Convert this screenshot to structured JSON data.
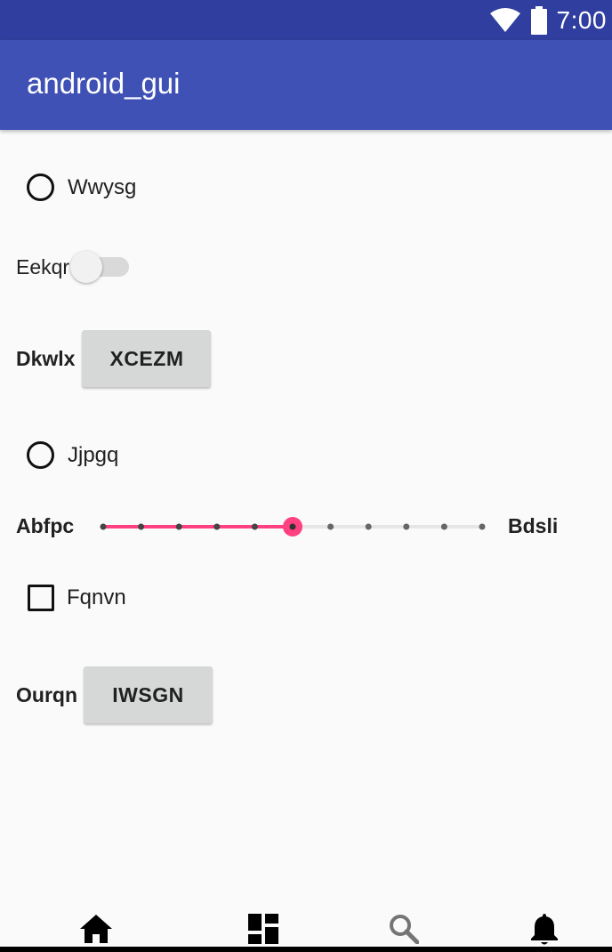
{
  "status_bar": {
    "time": "7:00"
  },
  "app_bar": {
    "title": "android_gui"
  },
  "form": {
    "radio_1_label": "Wwysg",
    "switch_label": "Eekqr",
    "button_row_1_label": "Dkwlx",
    "button_1_text": "XCEZM",
    "radio_2_label": "Jjpgq",
    "slider": {
      "min_label": "Abfpc",
      "max_label": "Bdsli",
      "steps": 10,
      "value": 5
    },
    "checkbox_label": "Fqnvn",
    "button_row_2_label": "Ourqn",
    "button_2_text": "IWSGN"
  },
  "bottom_nav": {
    "items": [
      {
        "icon": "home-icon"
      },
      {
        "icon": "dashboard-icon"
      },
      {
        "icon": "search-icon"
      },
      {
        "icon": "notifications-icon"
      }
    ]
  },
  "colors": {
    "status_bar": "#303f9f",
    "app_bar": "#3f51b5",
    "accent": "#ff4081"
  }
}
